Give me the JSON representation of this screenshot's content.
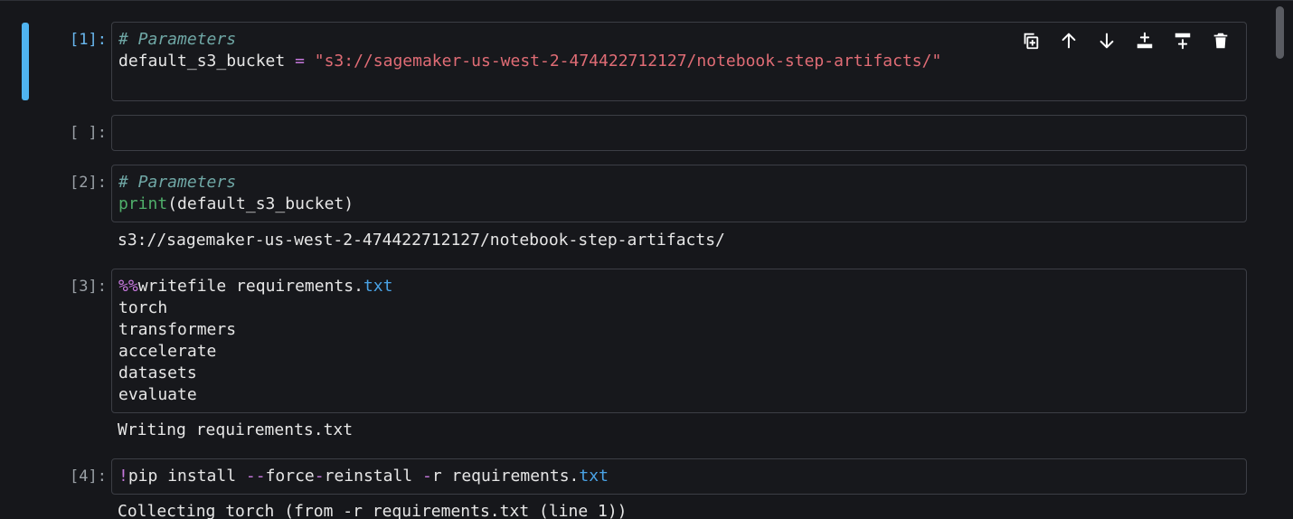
{
  "cells": [
    {
      "prompt": "[1]:",
      "code": {
        "comment": "# Parameters",
        "var": "default_s3_bucket",
        "op": " = ",
        "str": "\"s3://sagemaker-us-west-2-474422712127/notebook-step-artifacts/\""
      }
    },
    {
      "prompt": "[ ]:"
    },
    {
      "prompt": "[2]:",
      "code": {
        "comment": "# Parameters",
        "builtin": "print",
        "args": "(default_s3_bucket)"
      },
      "output": "s3://sagemaker-us-west-2-474422712127/notebook-step-artifacts/"
    },
    {
      "prompt": "[3]:",
      "code": {
        "magic": "%%",
        "magic_rest": "writefile requirements.",
        "ext": "txt",
        "lines": [
          "torch",
          "transformers",
          "accelerate",
          "datasets",
          "evaluate"
        ]
      },
      "output": "Writing requirements.txt"
    },
    {
      "prompt": "[4]:",
      "code": {
        "bang": "!",
        "t1": "pip install ",
        "op1": "--",
        "t2": "force",
        "op2": "-",
        "t3": "reinstall ",
        "op3": "-",
        "t4": "r requirements.",
        "ext": "txt"
      },
      "output": "Collecting torch (from -r requirements.txt (line 1))"
    }
  ],
  "toolbar": {
    "icons": [
      "duplicate-icon",
      "move-up-icon",
      "move-down-icon",
      "insert-above-icon",
      "insert-below-icon",
      "delete-icon"
    ]
  },
  "colors": {
    "accent": "#4fb3f0",
    "comment": "#6fa7a5",
    "string": "#e06c75",
    "builtin": "#4fae6a",
    "magic": "#c678dd",
    "extension": "#4aa3e6"
  }
}
